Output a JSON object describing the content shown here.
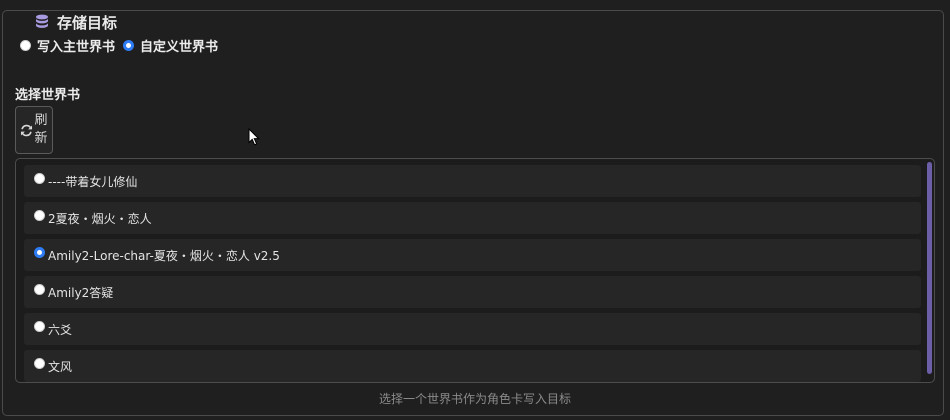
{
  "panel": {
    "title": "存储目标",
    "title_icon": "database-icon"
  },
  "mode": {
    "options": [
      {
        "label": "写入主世界书",
        "checked": false
      },
      {
        "label": "自定义世界书",
        "checked": true
      }
    ]
  },
  "selector": {
    "label": "选择世界书",
    "refresh_label": "刷新",
    "refresh_icon": "refresh-icon"
  },
  "worldbooks": [
    {
      "label": "----带着女儿修仙",
      "checked": false
    },
    {
      "label": "2夏夜・烟火・恋人",
      "checked": false
    },
    {
      "label": "Amily2-Lore-char-夏夜・烟火・恋人 v2.5",
      "checked": true
    },
    {
      "label": "Amily2答疑",
      "checked": false
    },
    {
      "label": "六爻",
      "checked": false
    },
    {
      "label": "文风",
      "checked": false
    }
  ],
  "hint": "选择一个世界书作为角色卡写入目标",
  "colors": {
    "background": "#1f1f1f",
    "radio_accent": "#2d7cf4",
    "scrollbar": "#6d5ea8"
  }
}
